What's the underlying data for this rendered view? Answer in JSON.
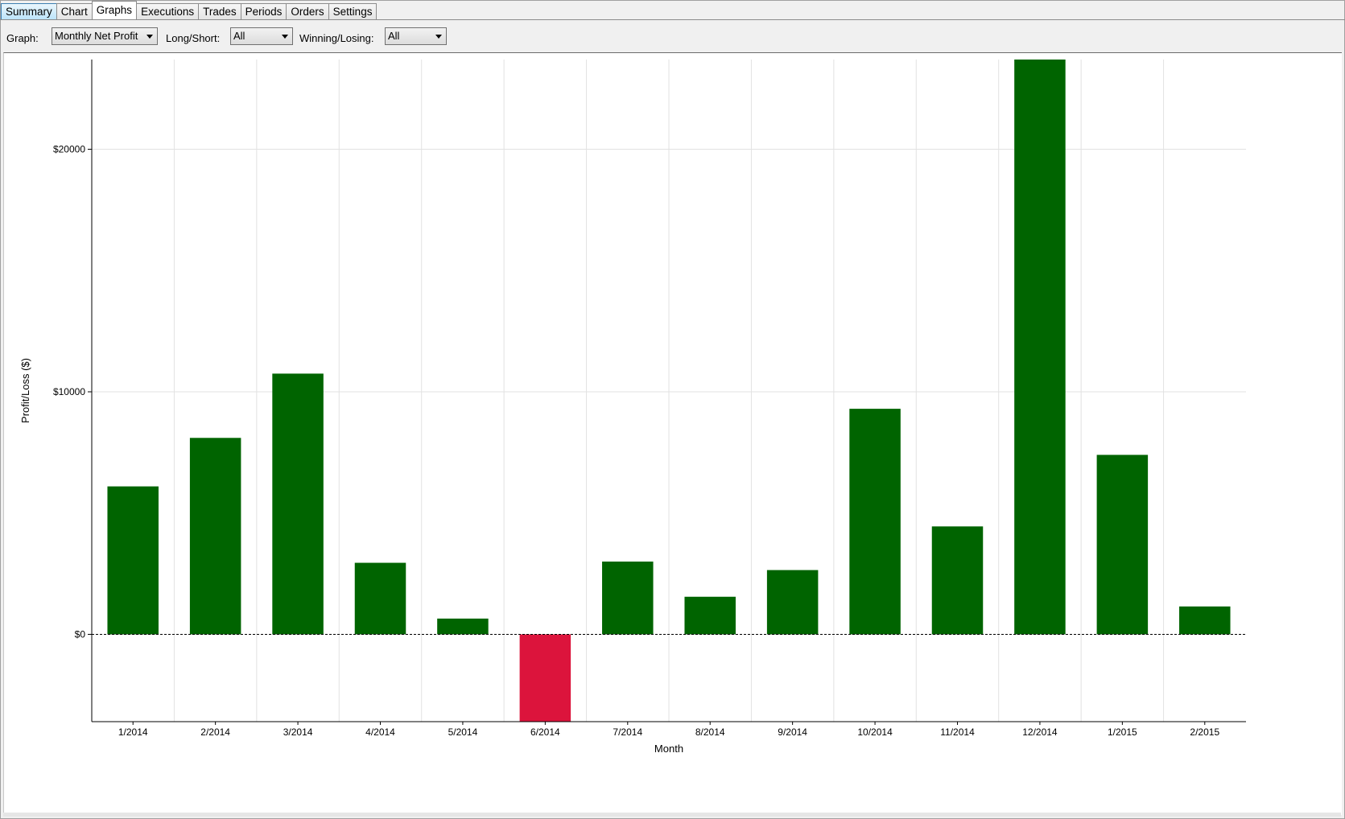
{
  "tabs": [
    {
      "label": "Summary",
      "state": "hot"
    },
    {
      "label": "Chart",
      "state": "normal"
    },
    {
      "label": "Graphs",
      "state": "active"
    },
    {
      "label": "Executions",
      "state": "normal"
    },
    {
      "label": "Trades",
      "state": "normal"
    },
    {
      "label": "Periods",
      "state": "normal"
    },
    {
      "label": "Orders",
      "state": "normal"
    },
    {
      "label": "Settings",
      "state": "normal"
    }
  ],
  "toolbar": {
    "graph_label": "Graph:",
    "graph_value": "Monthly Net Profit",
    "longshort_label": "Long/Short:",
    "longshort_value": "All",
    "winlose_label": "Winning/Losing:",
    "winlose_value": "All"
  },
  "colors": {
    "positive": "#006400",
    "negative": "#dc143c"
  },
  "chart_data": {
    "type": "bar",
    "title": "",
    "xlabel": "Month",
    "ylabel": "Profit/Loss ($)",
    "categories": [
      "1/2014",
      "2/2014",
      "3/2014",
      "4/2014",
      "5/2014",
      "6/2014",
      "7/2014",
      "8/2014",
      "9/2014",
      "10/2014",
      "11/2014",
      "12/2014",
      "1/2015",
      "2/2015"
    ],
    "values": [
      6100,
      8100,
      10750,
      2950,
      650,
      -3600,
      3000,
      1550,
      2650,
      9300,
      4450,
      23700,
      7400,
      1150
    ],
    "yticks": [
      0,
      10000,
      20000
    ],
    "ytick_labels": [
      "$0",
      "$10000",
      "$20000"
    ],
    "ylim": [
      -3600,
      23700
    ],
    "grid": true,
    "zero_line": "dashed"
  }
}
